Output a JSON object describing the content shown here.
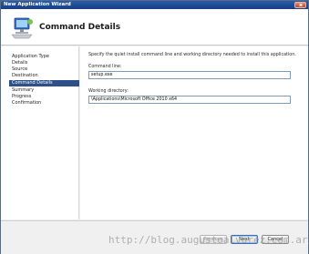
{
  "window": {
    "title": "New Application Wizard"
  },
  "header": {
    "heading": "Command Details",
    "icon": "computer-wizard-icon"
  },
  "nav": {
    "items": [
      {
        "label": "Application Type",
        "active": false
      },
      {
        "label": "Details",
        "active": false
      },
      {
        "label": "Source",
        "active": false
      },
      {
        "label": "Destination",
        "active": false
      },
      {
        "label": "Command Details",
        "active": true
      },
      {
        "label": "Summary",
        "active": false
      },
      {
        "label": "Progress",
        "active": false
      },
      {
        "label": "Confirmation",
        "active": false
      }
    ]
  },
  "main": {
    "description": "Specify the quiet install command line and working directory needed to install this application.",
    "command_line": {
      "label": "Command line:",
      "value": "setup.exe"
    },
    "working_directory": {
      "label": "Working directory:",
      "value": "\\Applications\\Microsoft Office 2010 x64"
    }
  },
  "buttons": {
    "previous": "Previous",
    "next": "Next",
    "cancel": "Cancel"
  },
  "watermark": "http://blog.augustoalvarez.com.ar/",
  "colors": {
    "title_bar": "#163e83",
    "nav_active": "#2d4f8a"
  }
}
